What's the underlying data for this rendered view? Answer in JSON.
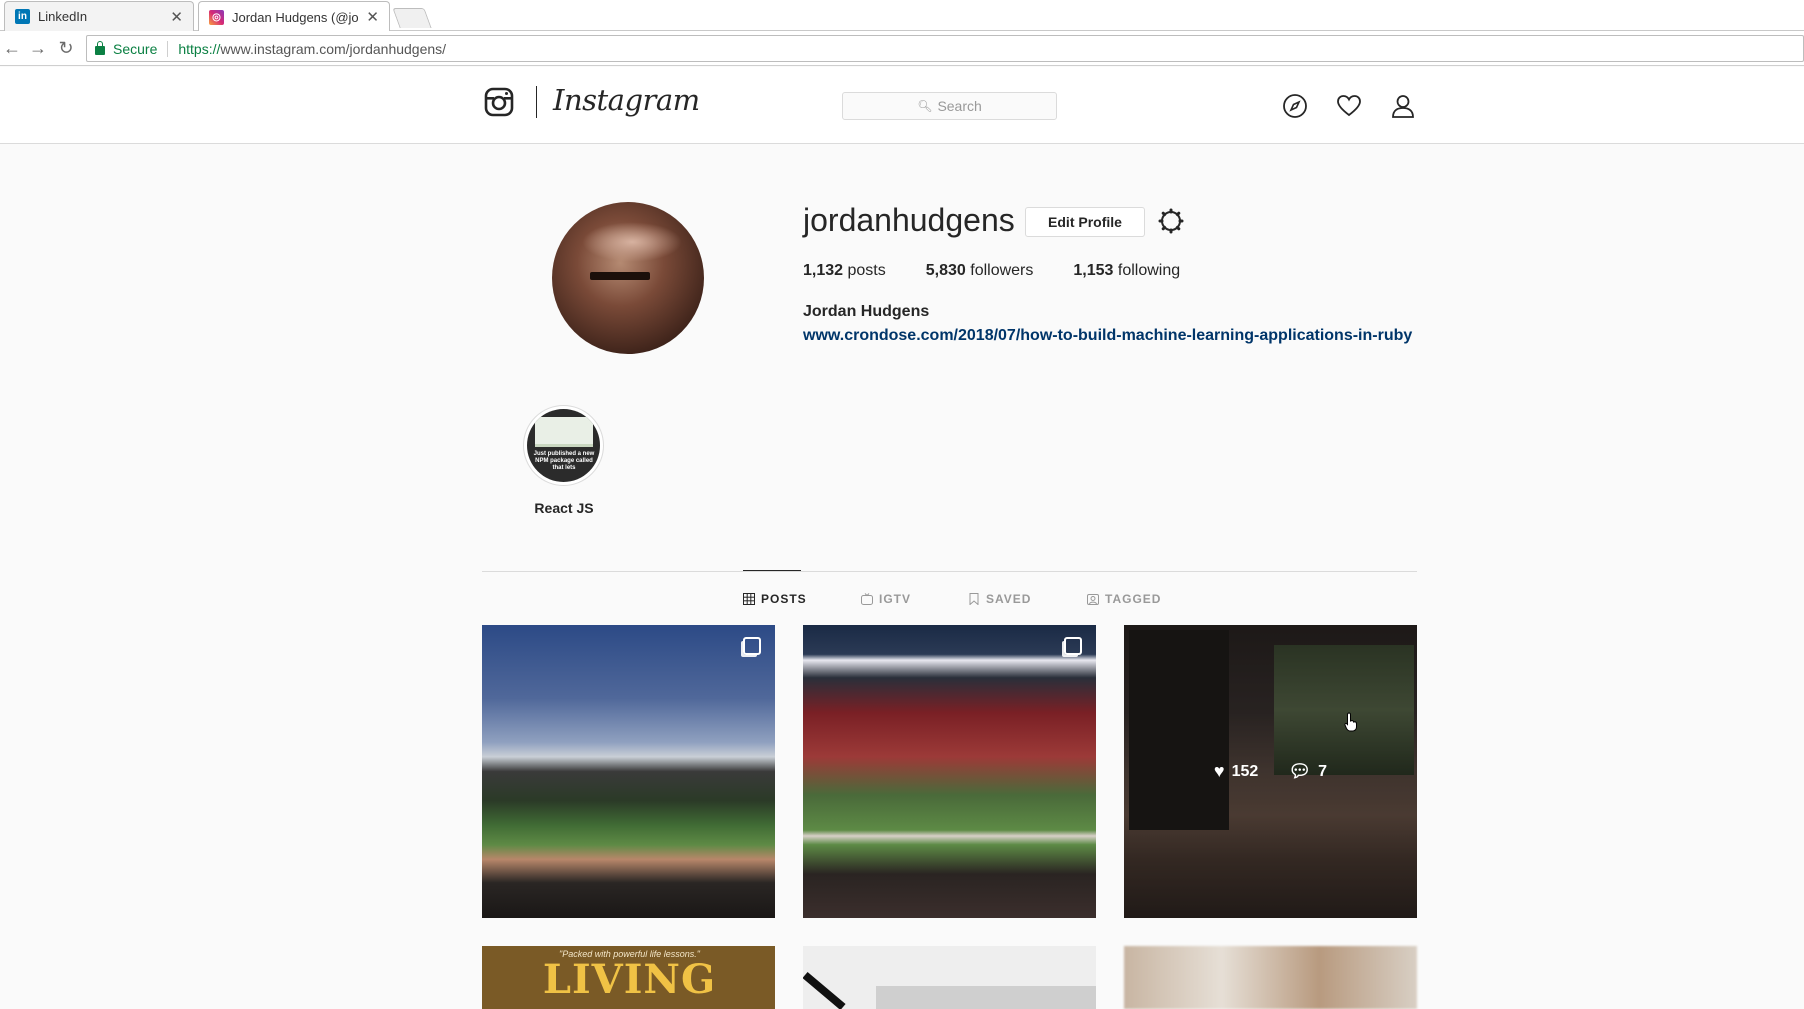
{
  "browser": {
    "tabs": [
      {
        "title": "LinkedIn",
        "favicon": "linkedin-icon",
        "active": false
      },
      {
        "title": "Jordan Hudgens (@jorda",
        "favicon": "instagram-icon",
        "active": true
      }
    ],
    "secure_label": "Secure",
    "url_scheme": "https://",
    "url_rest": "www.instagram.com/jordanhudgens/"
  },
  "ig_header": {
    "wordmark": "Instagram",
    "search_placeholder": "Search",
    "nav_icons": [
      "compass-icon",
      "heart-icon",
      "user-icon"
    ]
  },
  "profile": {
    "username": "jordanhudgens",
    "edit_button": "Edit Profile",
    "stats": [
      {
        "num": "1,132",
        "label": "posts"
      },
      {
        "num": "5,830",
        "label": "followers"
      },
      {
        "num": "1,153",
        "label": "following"
      }
    ],
    "full_name": "Jordan Hudgens",
    "link": "www.crondose.com/2018/07/how-to-build-machine-learning-applications-in-ruby"
  },
  "highlight": {
    "label": "React JS",
    "thumb_text": "Just published a new NPM package called that lets"
  },
  "tabs": [
    {
      "label": "POSTS",
      "icon": "grid-icon",
      "active": true
    },
    {
      "label": "IGTV",
      "icon": "igtv-icon",
      "active": false
    },
    {
      "label": "SAVED",
      "icon": "bookmark-icon",
      "active": false
    },
    {
      "label": "TAGGED",
      "icon": "tag-icon",
      "active": false
    }
  ],
  "posts": {
    "hover_likes": "152",
    "hover_comments": "7",
    "book_quote": "\"Packed with powerful life lessons.\"",
    "book_title": "LIVING"
  },
  "colors": {
    "link": "#003569",
    "secure": "#0b8043",
    "text": "#262626",
    "muted": "#999999"
  }
}
